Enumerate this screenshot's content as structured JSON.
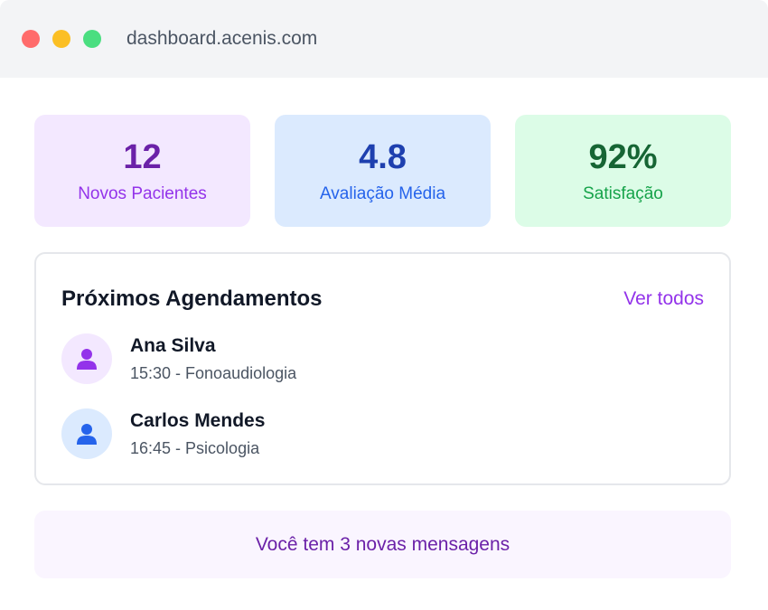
{
  "browser": {
    "url": "dashboard.acenis.com"
  },
  "stats": [
    {
      "value": "12",
      "label": "Novos Pacientes",
      "color": "#6b21a8"
    },
    {
      "value": "4.8",
      "label": "Avaliação Média",
      "color": "#1e40af"
    },
    {
      "value": "92%",
      "label": "Satisfação",
      "color": "#166534"
    }
  ],
  "appointments": {
    "title": "Próximos Agendamentos",
    "view_all": "Ver todos",
    "items": [
      {
        "name": "Ana Silva",
        "detail": "15:30 - Fonoaudiologia",
        "icon": "user-icon",
        "accent": "#9333ea"
      },
      {
        "name": "Carlos Mendes",
        "detail": "16:45 - Psicologia",
        "icon": "user-icon",
        "accent": "#2563eb"
      }
    ]
  },
  "messages_banner": "Você tem 3 novas mensagens"
}
